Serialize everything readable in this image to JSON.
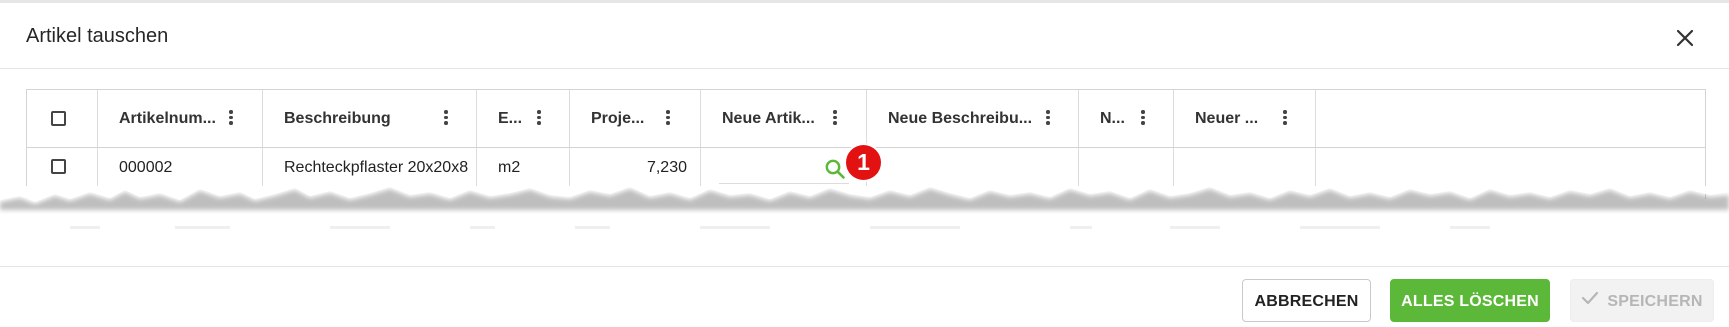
{
  "dialog": {
    "title": "Artikel tauschen",
    "close_icon": "close-icon"
  },
  "grid": {
    "columns": [
      {
        "label": "",
        "kind": "checkbox"
      },
      {
        "label": "Artikelnum..."
      },
      {
        "label": "Beschreibung"
      },
      {
        "label": "E..."
      },
      {
        "label": "Proje..."
      },
      {
        "label": "Neue Artik..."
      },
      {
        "label": "Neue Beschreibu..."
      },
      {
        "label": "N..."
      },
      {
        "label": "Neuer ..."
      }
    ],
    "rows": [
      {
        "checked": false,
        "artikelnummer": "000002",
        "beschreibung": "Rechteckpflaster 20x20x8",
        "einheit": "m2",
        "projektmenge": "7,230",
        "neue_artikelnummer": "",
        "neue_beschreibung": "",
        "neue_einheit": "",
        "neuer_preis": "",
        "search_icon": "search-icon"
      }
    ]
  },
  "annotation": {
    "badge_number": "1",
    "color": "#e31212"
  },
  "footer": {
    "cancel_label": "ABBRECHEN",
    "delete_all_label": "ALLES LÖSCHEN",
    "save_label": "SPEICHERN",
    "save_icon": "check-icon",
    "save_enabled": false
  },
  "colors": {
    "primary_green": "#5cb838",
    "search_icon_green": "#5cb838",
    "disabled_text": "#b6b6b6"
  }
}
